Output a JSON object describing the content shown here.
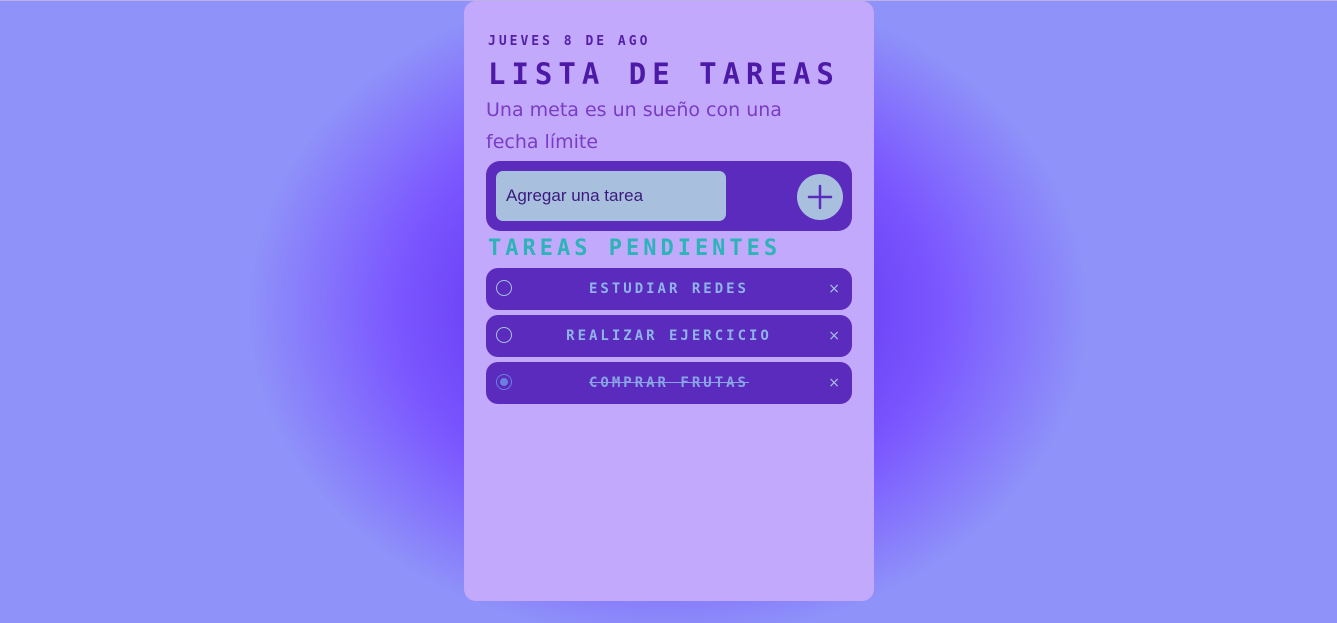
{
  "header": {
    "date": "Jueves 8 de ago",
    "title": "Lista de tareas",
    "quote": "Una meta es un sueño con una fecha límite"
  },
  "add_task": {
    "placeholder": "Agregar una tarea",
    "value": "",
    "button_icon": "plus-icon"
  },
  "section": {
    "title": "Tareas pendientes"
  },
  "tasks": [
    {
      "label": "Estudiar redes",
      "done": false
    },
    {
      "label": "Realizar ejercicio",
      "done": false
    },
    {
      "label": "Comprar frutas",
      "done": true
    }
  ],
  "icons": {
    "check": "circle-check-icon",
    "delete": "close-icon",
    "delete_glyph": "×"
  },
  "colors": {
    "card": "#c3a9fb",
    "panel": "#5a2bbd",
    "input": "#a8c0dd",
    "title": "#4c1aa6",
    "section": "#2cb4b8"
  }
}
